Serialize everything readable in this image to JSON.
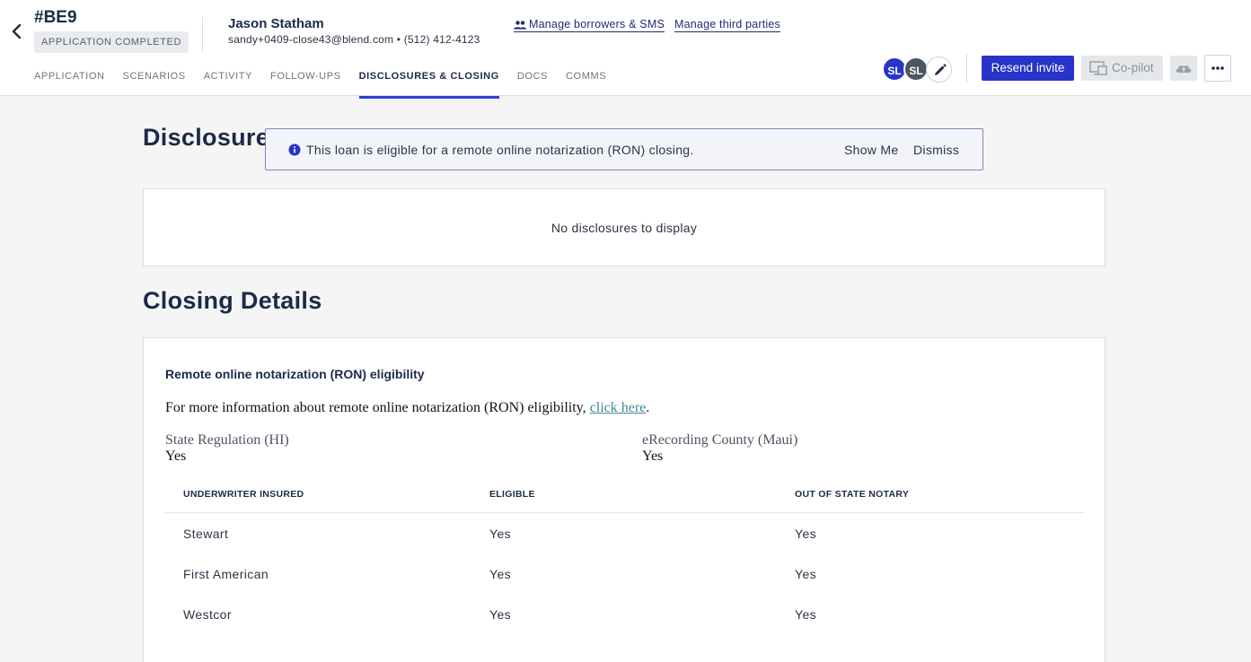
{
  "header": {
    "app_id": "#BE9",
    "status": "APPLICATION COMPLETED",
    "borrower_name": "Jason Statham",
    "borrower_contact": "sandy+0409-close43@blend.com • (512) 412-4123",
    "manage_borrowers": "Manage borrowers & SMS",
    "manage_third_parties": "Manage third parties"
  },
  "tabs": [
    {
      "label": "APPLICATION"
    },
    {
      "label": "SCENARIOS"
    },
    {
      "label": "ACTIVITY"
    },
    {
      "label": "FOLLOW-UPS"
    },
    {
      "label": "DISCLOSURES & CLOSING",
      "active": true
    },
    {
      "label": "DOCS"
    },
    {
      "label": "COMMS"
    }
  ],
  "avatars": [
    {
      "initials": "SL",
      "color": "#2833c9"
    },
    {
      "initials": "SL",
      "color": "#4b5563"
    }
  ],
  "actions": {
    "resend_invite": "Resend invite",
    "copilot": "Co-pilot"
  },
  "disclosures": {
    "title": "Disclosures",
    "banner_message": "This loan is eligible for a remote online notarization (RON) closing.",
    "banner_show_me": "Show Me",
    "banner_dismiss": "Dismiss",
    "empty_message": "No disclosures to display"
  },
  "closing": {
    "title": "Closing Details",
    "ron_heading": "Remote online notarization (RON) eligibility",
    "info_text": "For more information about remote online notarization (RON) eligibility, ",
    "info_link": "click here",
    "info_end": ".",
    "state_label": "State Regulation (HI)",
    "state_value": "Yes",
    "county_label": "eRecording County (Maui)",
    "county_value": "Yes",
    "table": {
      "columns": [
        "UNDERWRITER INSURED",
        "ELIGIBLE",
        "OUT OF STATE NOTARY"
      ],
      "rows": [
        [
          "Stewart",
          "Yes",
          "Yes"
        ],
        [
          "First American",
          "Yes",
          "Yes"
        ],
        [
          "Westcor",
          "Yes",
          "Yes"
        ]
      ]
    }
  },
  "colors": {
    "primary": "#2833c9",
    "active_tab_underline": "#2e3fd6",
    "link": "#3d8a96"
  }
}
